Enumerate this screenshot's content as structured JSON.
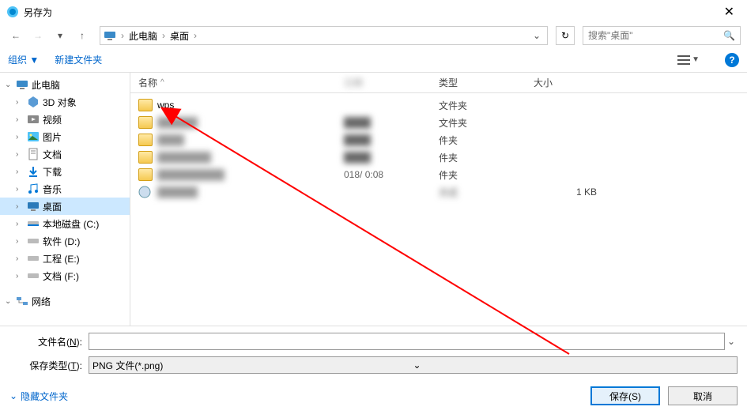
{
  "window": {
    "title": "另存为"
  },
  "breadcrumb": {
    "pc": "此电脑",
    "desktop": "桌面"
  },
  "search": {
    "placeholder": "搜索\"桌面\""
  },
  "toolbar": {
    "organize": "组织 ▼",
    "new_folder": "新建文件夹"
  },
  "sidebar": {
    "this_pc": "此电脑",
    "items": [
      {
        "label": "3D 对象",
        "icon": "3d"
      },
      {
        "label": "视频",
        "icon": "video"
      },
      {
        "label": "图片",
        "icon": "picture"
      },
      {
        "label": "文档",
        "icon": "document"
      },
      {
        "label": "下载",
        "icon": "download"
      },
      {
        "label": "音乐",
        "icon": "music"
      },
      {
        "label": "桌面",
        "icon": "desktop",
        "selected": true
      },
      {
        "label": "本地磁盘 (C:)",
        "icon": "disk"
      },
      {
        "label": "软件 (D:)",
        "icon": "disk"
      },
      {
        "label": "工程 (E:)",
        "icon": "disk"
      },
      {
        "label": "文档 (F:)",
        "icon": "disk"
      }
    ],
    "network": "网络"
  },
  "columns": {
    "name": "名称",
    "date": "日期",
    "type": "类型",
    "size": "大小"
  },
  "files": [
    {
      "name": "wps",
      "type": "文件夹",
      "date": "",
      "size": ""
    },
    {
      "name": "",
      "type": "文件夹",
      "date": "",
      "size": "",
      "blurred": true
    },
    {
      "name": "",
      "type": "件夹",
      "date": "",
      "size": "",
      "blurred": true
    },
    {
      "name": "",
      "type": "件夹",
      "date": "",
      "size": "",
      "blurred": true
    },
    {
      "name": "",
      "type": "件夹",
      "date": "018/         0:08",
      "size": "",
      "blurred": true
    },
    {
      "name": "",
      "type": "方式",
      "date": "",
      "size": "1 KB",
      "blurred": true
    }
  ],
  "fields": {
    "filename_label": "文件名(",
    "filename_key": "N",
    "filename_value": "",
    "filetype_label": "保存类型(",
    "filetype_key": "T",
    "filetype_value": "PNG 文件(*.png)"
  },
  "footer": {
    "hide_folders": "隐藏文件夹",
    "save": "保存(S)",
    "cancel": "取消"
  }
}
